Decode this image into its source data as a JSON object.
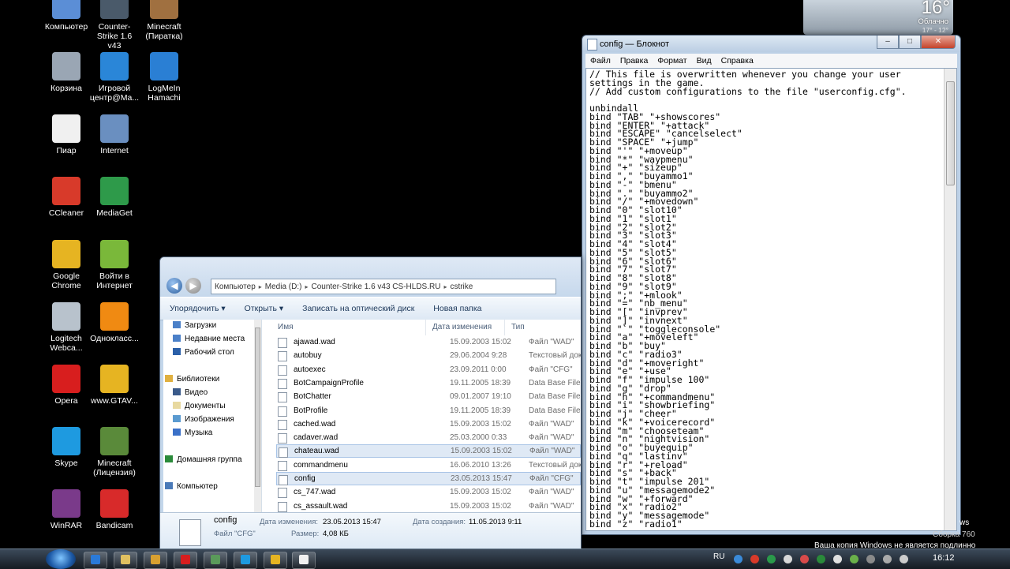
{
  "desktop": {
    "icons": [
      {
        "label": "Компьютер",
        "color": "#5b8ed6"
      },
      {
        "label": "Counter-Strike 1.6 v43",
        "color": "#4a5a6a"
      },
      {
        "label": "Minecraft (Пиратка)",
        "color": "#a07040"
      },
      {
        "label": "Корзина",
        "color": "#9aa6b4"
      },
      {
        "label": "Игровой центр@Ma...",
        "color": "#2a86d8"
      },
      {
        "label": "LogMeIn Hamachi",
        "color": "#2a7fd4"
      },
      {
        "label": "Пиар",
        "color": "#f0f0f0"
      },
      {
        "label": "Internet",
        "color": "#6a8fc0"
      },
      {
        "label": "CCleaner",
        "color": "#d83a2a"
      },
      {
        "label": "MediaGet",
        "color": "#2e9a4a"
      },
      {
        "label": "Google Chrome",
        "color": "#e6b422"
      },
      {
        "label": "Войти в Интернет",
        "color": "#7ab83a"
      },
      {
        "label": "Logitech Webca...",
        "color": "#b8c2cc"
      },
      {
        "label": "Однокласс...",
        "color": "#f08a12"
      },
      {
        "label": "Opera",
        "color": "#d81e1e"
      },
      {
        "label": "www.GTAV...",
        "color": "#e6b422"
      },
      {
        "label": "Skype",
        "color": "#1e9ae0"
      },
      {
        "label": "Minecraft (Лицензия)",
        "color": "#5a8a3a"
      },
      {
        "label": "WinRAR",
        "color": "#7a3a8a"
      },
      {
        "label": "Bandicam",
        "color": "#d82a2a"
      }
    ]
  },
  "weather": {
    "temp": "16°",
    "condition": "Облачно",
    "range": "17° - 12°"
  },
  "notepad": {
    "title": "config — Блокнот",
    "menu": [
      "Файл",
      "Правка",
      "Формат",
      "Вид",
      "Справка"
    ],
    "buttons": {
      "minimize": "–",
      "maximize": "□",
      "close": "✕"
    },
    "lines": [
      "// This file is overwritten whenever you change your user",
      "settings in the game.",
      "// Add custom configurations to the file \"userconfig.cfg\".",
      "",
      "unbindall",
      "bind \"TAB\" \"+showscores\"",
      "bind \"ENTER\" \"+attack\"",
      "bind \"ESCAPE\" \"cancelselect\"",
      "bind \"SPACE\" \"+jump\"",
      "bind \"'\" \"+moveup\"",
      "bind \"*\" \"waypmenu\"",
      "bind \"+\" \"sizeup\"",
      "bind \",\" \"buyammo1\"",
      "bind \"-\" \"bmenu\"",
      "bind \".\" \"buyammo2\"",
      "bind \"/\" \"+movedown\"",
      "bind \"0\" \"slot10\"",
      "bind \"1\" \"slot1\"",
      "bind \"2\" \"slot2\"",
      "bind \"3\" \"slot3\"",
      "bind \"4\" \"slot4\"",
      "bind \"5\" \"slot5\"",
      "bind \"6\" \"slot6\"",
      "bind \"7\" \"slot7\"",
      "bind \"8\" \"slot8\"",
      "bind \"9\" \"slot9\"",
      "bind \";\" \"+mlook\"",
      "bind \"=\" \"nb_menu\"",
      "bind \"[\" \"invprev\"",
      "bind \"]\" \"invnext\"",
      "bind \"`\" \"toggleconsole\"",
      "bind \"a\" \"+moveleft\"",
      "bind \"b\" \"buy\"",
      "bind \"c\" \"radio3\"",
      "bind \"d\" \"+moveright\"",
      "bind \"e\" \"+use\"",
      "bind \"f\" \"impulse 100\"",
      "bind \"g\" \"drop\"",
      "bind \"h\" \"+commandmenu\"",
      "bind \"i\" \"showbriefing\"",
      "bind \"j\" \"cheer\"",
      "bind \"k\" \"+voicerecord\"",
      "bind \"m\" \"chooseteam\"",
      "bind \"n\" \"nightvision\"",
      "bind \"o\" \"buyequip\"",
      "bind \"q\" \"lastinv\"",
      "bind \"r\" \"+reload\"",
      "bind \"s\" \"+back\"",
      "bind \"t\" \"impulse 201\"",
      "bind \"u\" \"messagemode2\"",
      "bind \"w\" \"+forward\"",
      "bind \"x\" \"radio2\"",
      "bind \"y\" \"messagemode\"",
      "bind \"z\" \"radio1\""
    ]
  },
  "explorer": {
    "address": [
      "Компьютер",
      "Media (D:)",
      "Counter-Strike 1.6 v43 CS-HLDS.RU",
      "cstrike"
    ],
    "toolbar": [
      "Упорядочить ▾",
      "Открыть ▾",
      "Записать на оптический диск",
      "Новая папка"
    ],
    "nav": [
      {
        "label": "Загрузки",
        "color": "#4b80c8"
      },
      {
        "label": "Недавние места",
        "color": "#4b80c8"
      },
      {
        "label": "Рабочий стол",
        "color": "#2a5fa8"
      },
      {
        "label": "Библиотеки",
        "color": "#e0b040"
      },
      {
        "label": "Видео",
        "color": "#3a5a8a"
      },
      {
        "label": "Документы",
        "color": "#e8d9a0"
      },
      {
        "label": "Изображения",
        "color": "#5a9ad0"
      },
      {
        "label": "Музыка",
        "color": "#3a70c8"
      },
      {
        "label": "Домашняя группа",
        "color": "#2a8a3a"
      },
      {
        "label": "Компьютер",
        "color": "#4a7ab8"
      }
    ],
    "columns": [
      "Имя",
      "Дата изменения",
      "Тип"
    ],
    "files": [
      {
        "name": "ajawad.wad",
        "date": "15.09.2003 15:02",
        "type": "Файл \"WAD\"",
        "selected": false
      },
      {
        "name": "autobuy",
        "date": "29.06.2004 9:28",
        "type": "Текстовый док",
        "selected": false
      },
      {
        "name": "autoexec",
        "date": "23.09.2011 0:00",
        "type": "Файл \"CFG\"",
        "selected": false
      },
      {
        "name": "BotCampaignProfile",
        "date": "19.11.2005 18:39",
        "type": "Data Base File",
        "selected": false
      },
      {
        "name": "BotChatter",
        "date": "09.01.2007 19:10",
        "type": "Data Base File",
        "selected": false
      },
      {
        "name": "BotProfile",
        "date": "19.11.2005 18:39",
        "type": "Data Base File",
        "selected": false
      },
      {
        "name": "cached.wad",
        "date": "15.09.2003 15:02",
        "type": "Файл \"WAD\"",
        "selected": false
      },
      {
        "name": "cadaver.wad",
        "date": "25.03.2000 0:33",
        "type": "Файл \"WAD\"",
        "selected": false
      },
      {
        "name": "chateau.wad",
        "date": "15.09.2003 15:02",
        "type": "Файл \"WAD\"",
        "selected": true
      },
      {
        "name": "commandmenu",
        "date": "16.06.2010 13:26",
        "type": "Текстовый док",
        "selected": false
      },
      {
        "name": "config",
        "date": "23.05.2013 15:47",
        "type": "Файл \"CFG\"",
        "selected": true
      },
      {
        "name": "cs_747.wad",
        "date": "15.09.2003 15:02",
        "type": "Файл \"WAD\"",
        "selected": false
      },
      {
        "name": "cs_assault.wad",
        "date": "15.09.2003 15:02",
        "type": "Файл \"WAD\"",
        "selected": false
      }
    ],
    "details": {
      "name": "config",
      "type": "Файл \"CFG\"",
      "modified_label": "Дата изменения:",
      "modified": "23.05.2013 15:47",
      "created_label": "Дата создания:",
      "created": "11.05.2013 9:11",
      "size_label": "Размер:",
      "size": "4,08 КБ"
    }
  },
  "watermark": {
    "line1": "ws",
    "line2": "Сборка 760",
    "line3": "Ваша копия Windows не является подлинно"
  },
  "taskbar": {
    "language": "RU",
    "clock": "16:12",
    "apps": [
      {
        "name": "ie",
        "color": "#2a7ad8"
      },
      {
        "name": "explorer",
        "color": "#e0c060"
      },
      {
        "name": "media",
        "color": "#d8a030"
      },
      {
        "name": "opera",
        "color": "#d81e1e"
      },
      {
        "name": "network",
        "color": "#5a9a5a"
      },
      {
        "name": "skype",
        "color": "#1e9ae0"
      },
      {
        "name": "chrome",
        "color": "#e6b422"
      },
      {
        "name": "notepad",
        "color": "#f0f0f0"
      }
    ],
    "tray": [
      "#3a8ad8",
      "#d83a2a",
      "#2a9a4a",
      "#d8d8d8",
      "#d84a4a",
      "#2a8a3a",
      "#e0e0e0",
      "#6ab04a",
      "#8a8a8a",
      "#aaaaaa",
      "#cccccc"
    ]
  }
}
